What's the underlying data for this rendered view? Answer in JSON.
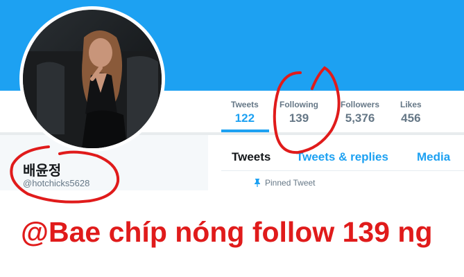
{
  "profile": {
    "display_name": "배윤정",
    "handle": "@hotchicks5628"
  },
  "stats": [
    {
      "label": "Tweets",
      "value": "122",
      "active": true
    },
    {
      "label": "Following",
      "value": "139",
      "active": false
    },
    {
      "label": "Followers",
      "value": "5,376",
      "active": false
    },
    {
      "label": "Likes",
      "value": "456",
      "active": false
    }
  ],
  "tabs": [
    {
      "label": "Tweets",
      "active": true
    },
    {
      "label": "Tweets & replies",
      "active": false
    },
    {
      "label": "Media",
      "active": false
    }
  ],
  "pinned": {
    "label": "Pinned Tweet",
    "icon": "pin-icon"
  },
  "caption": "@Bae chíp nóng follow 139 ng",
  "colors": {
    "banner": "#1da1f2",
    "accent": "#1da1f2",
    "annotation": "#e01b1b"
  }
}
